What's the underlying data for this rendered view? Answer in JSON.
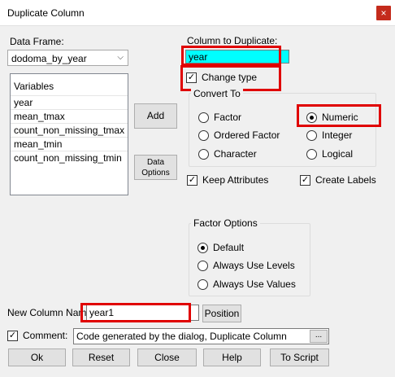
{
  "window": {
    "title": "Duplicate Column",
    "close_symbol": "×"
  },
  "data_frame": {
    "label": "Data Frame:",
    "selected": "dodoma_by_year"
  },
  "variables": {
    "header": "Variables",
    "items": [
      "year",
      "mean_tmax",
      "count_non_missing_tmax",
      "mean_tmin",
      "count_non_missing_tmin"
    ]
  },
  "buttons": {
    "add": "Add",
    "data_options_line1": "Data",
    "data_options_line2": "Options",
    "position": "Position",
    "ok": "Ok",
    "reset": "Reset",
    "close": "Close",
    "help": "Help",
    "to_script": "To Script",
    "comment_more": "..."
  },
  "column_to_duplicate": {
    "label": "Column to Duplicate:",
    "value": "year"
  },
  "change_type": {
    "label": "Change type",
    "checked": true
  },
  "convert_to": {
    "title": "Convert To",
    "options": [
      "Factor",
      "Ordered Factor",
      "Character",
      "Numeric",
      "Integer",
      "Logical"
    ],
    "selected": "Numeric"
  },
  "keep_attributes": {
    "label": "Keep Attributes",
    "checked": true
  },
  "create_labels": {
    "label": "Create Labels",
    "checked": true
  },
  "factor_options": {
    "title": "Factor Options",
    "options": [
      "Default",
      "Always Use Levels",
      "Always Use Values"
    ],
    "selected": "Default"
  },
  "new_column": {
    "label": "New Column Name:",
    "value": "year1"
  },
  "comment": {
    "label": "Comment:",
    "checked": true,
    "value": "Code generated by the dialog, Duplicate Column"
  },
  "colors": {
    "highlight": "#00ffff",
    "annotation_red": "#e00000",
    "close_red": "#c42b1c"
  }
}
